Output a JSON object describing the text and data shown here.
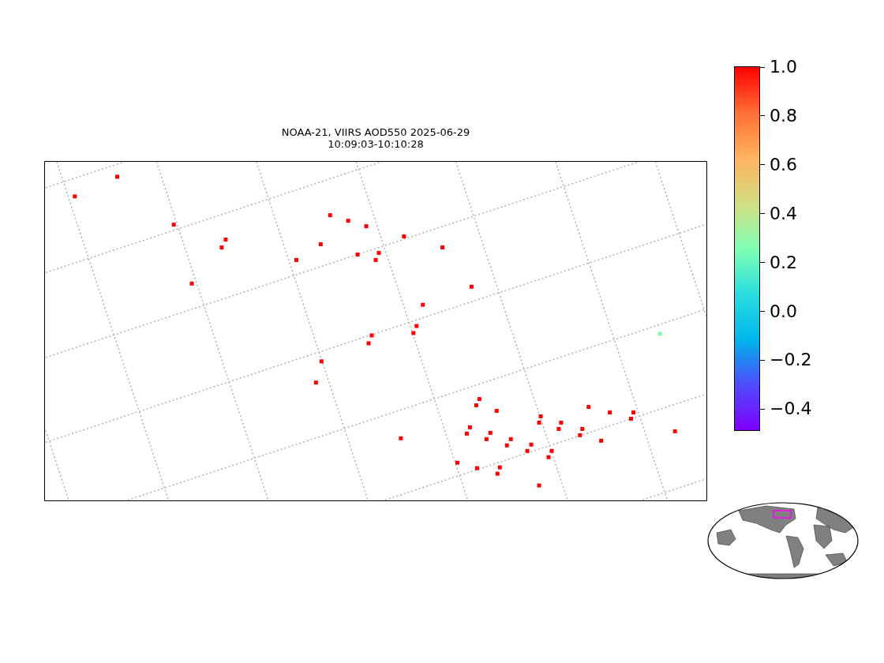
{
  "plot": {
    "title_lines": [
      "NOAA-21, VIIRS AOD550 2025-06-29",
      "10:09:03-10:10:28"
    ]
  },
  "colorbar": {
    "ticks": [
      "1.0",
      "0.8",
      "0.6",
      "0.4",
      "0.2",
      "0.0",
      "−0.2",
      "−0.4"
    ]
  }
}
